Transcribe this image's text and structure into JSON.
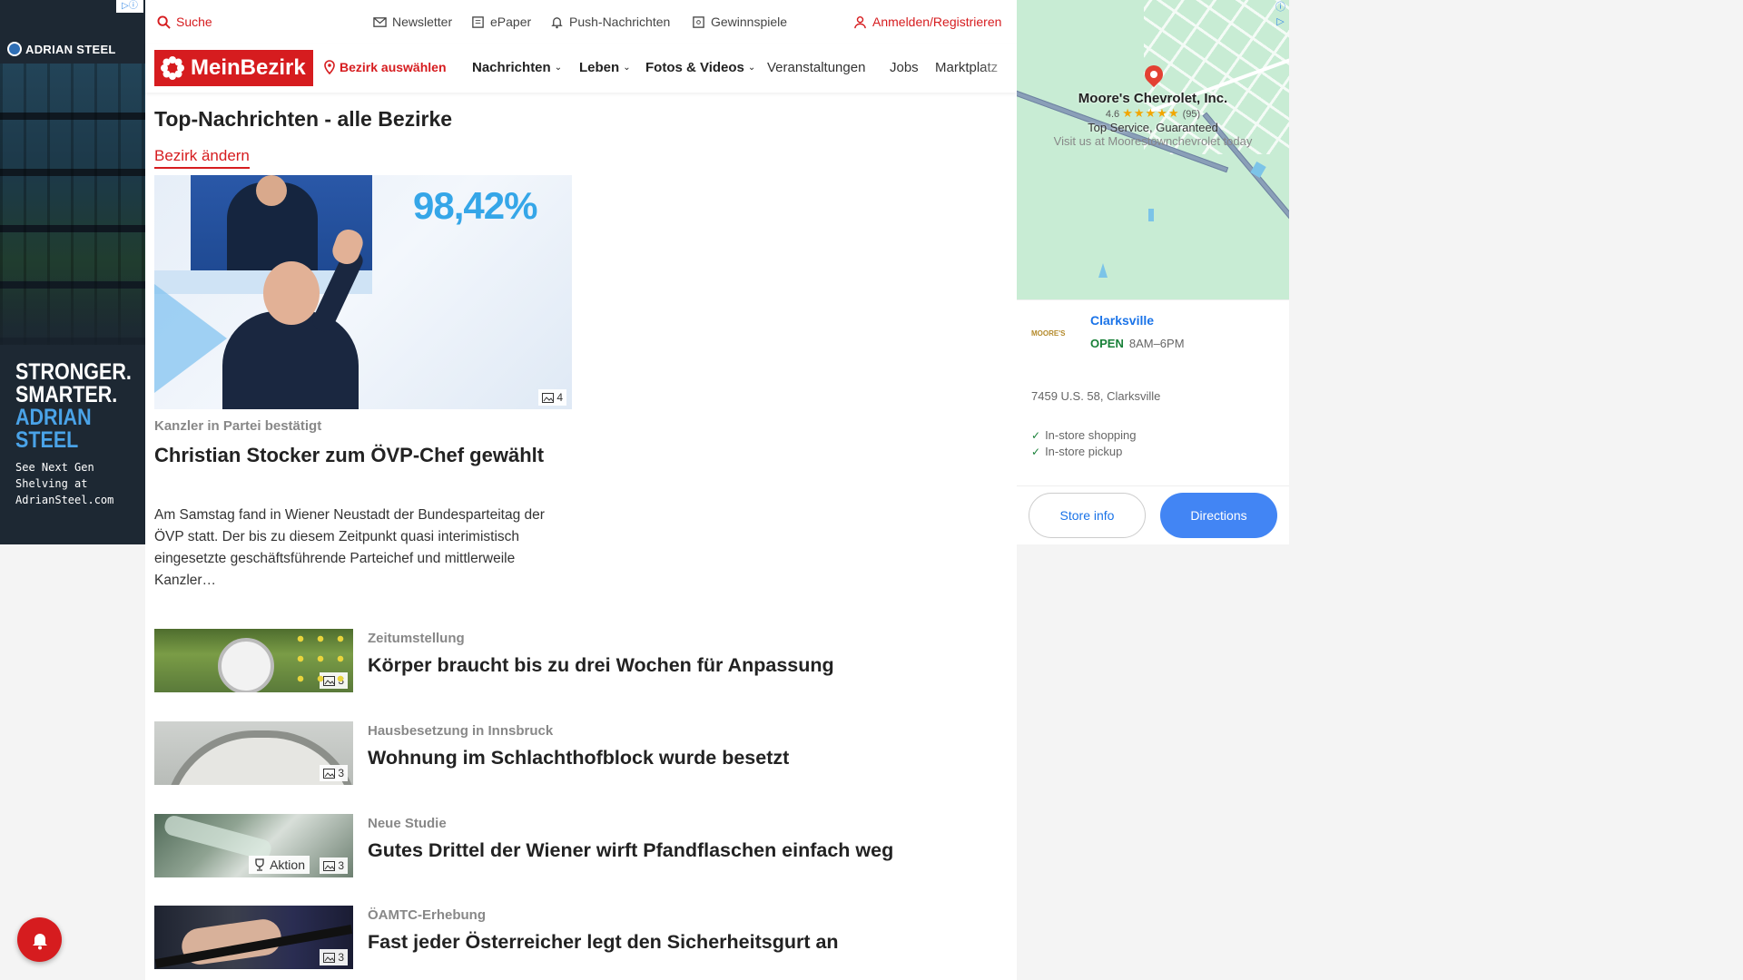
{
  "ad_left": {
    "brand": "ADRIAN STEEL",
    "slogan_line1": "STRONGER.",
    "slogan_line2": "SMARTER.",
    "slogan_blue1": "ADRIAN",
    "slogan_blue2": "STEEL",
    "small_text": "See Next Gen\nShelving at\nAdrianSteel.com",
    "adchoices_icon": "adchoices-icon"
  },
  "topbar": {
    "search": "Suche",
    "newsletter": "Newsletter",
    "epaper": "ePaper",
    "push": "Push-Nachrichten",
    "gewinnspiele": "Gewinnspiele",
    "login": "Anmelden/Registrieren"
  },
  "nav": {
    "logo": "MeinBezirk",
    "district": "Bezirk auswählen",
    "items": [
      {
        "label": "Nachrichten",
        "chevron": true
      },
      {
        "label": "Leben",
        "chevron": true
      },
      {
        "label": "Fotos & Videos",
        "chevron": true
      },
      {
        "label": "Veranstaltungen",
        "chevron": false
      },
      {
        "label": "Jobs",
        "chevron": false
      },
      {
        "label": "Marktplatz",
        "chevron": false
      }
    ]
  },
  "page": {
    "title": "Top-Nachrichten - alle Bezirke",
    "change_district": "Bezirk ändern"
  },
  "lead": {
    "image_overlay_text": "98,42%",
    "image_count": "4",
    "kicker": "Kanzler in Partei bestätigt",
    "title": "Christian Stocker zum ÖVP-Chef gewählt",
    "teaser": "Am Samstag fand in Wiener Neustadt der Bundesparteitag der ÖVP statt. Der bis zu diesem Zeitpunkt quasi interimistisch eingesetzte geschäftsführende Parteichef und mittlerweile Kanzler…"
  },
  "articles": [
    {
      "kicker": "Zeitumstellung",
      "title": "Körper braucht bis zu drei Wochen für Anpassung",
      "image_count": "3"
    },
    {
      "kicker": "Hausbesetzung in Innsbruck",
      "title": "Wohnung im Schlachthofblock wurde besetzt",
      "image_count": "3"
    },
    {
      "kicker": "Neue Studie",
      "title": "Gutes Drittel der Wiener wirft Pfandflaschen einfach weg",
      "image_count": "3",
      "badge": "Aktion"
    },
    {
      "kicker": "ÖAMTC-Erhebung",
      "title": "Fast jeder Österreicher legt den Sicherheitsgurt an",
      "image_count": "3"
    }
  ],
  "map_ad": {
    "place_name": "Moore's Chevrolet, Inc.",
    "rating": "4.6",
    "stars": "★★★★★",
    "reviews": "(95)",
    "tagline": "Top Service, Guaranteed",
    "visit": "Visit us at Moorestownchevrolet today",
    "logo_text": "MOORE'S",
    "city": "Clarksville",
    "open": "OPEN",
    "hours": "8AM–6PM",
    "address": "7459 U.S. 58, Clarksville",
    "features": [
      "In-store shopping",
      "In-store pickup"
    ],
    "store_info": "Store info",
    "directions": "Directions"
  },
  "colors": {
    "brand_red": "#d61c1f",
    "google_blue": "#4285f4"
  }
}
